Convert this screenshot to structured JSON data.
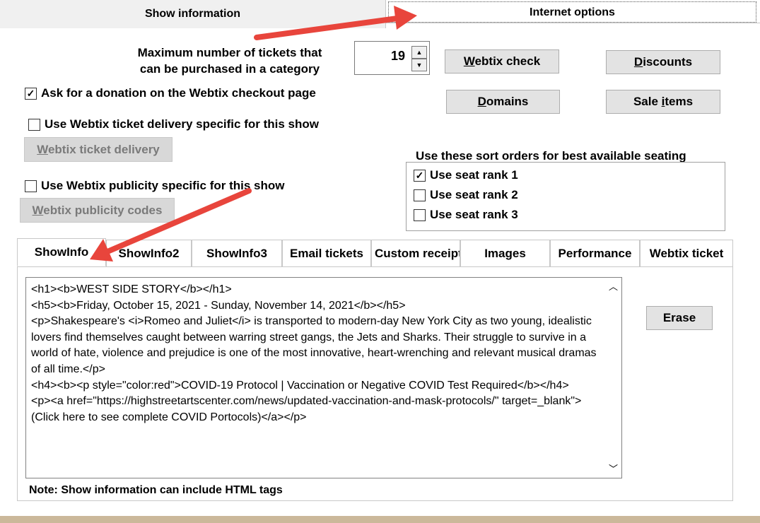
{
  "top_tabs": {
    "show_information": "Show information",
    "internet_options": "Internet options"
  },
  "max_tickets": {
    "label_line1": "Maximum number of tickets that",
    "label_line2": "can be purchased in a category",
    "value": "19"
  },
  "buttons": {
    "webtix_check_u": "W",
    "webtix_check_rest": "ebtix check",
    "discounts_u": "D",
    "discounts_rest": "iscounts",
    "domains_u": "D",
    "domains_rest": "omains",
    "sale_items_pre": "Sale ",
    "sale_items_u": "i",
    "sale_items_rest": "tems",
    "webtix_delivery_u": "W",
    "webtix_delivery_rest": "ebtix ticket delivery",
    "webtix_publicity_u": "W",
    "webtix_publicity_rest": "ebtix publicity codes",
    "erase": "Erase"
  },
  "checkboxes": {
    "donation": {
      "label": "Ask for a donation on the Webtix checkout page",
      "checked": true
    },
    "delivery": {
      "label": "Use Webtix ticket delivery specific for this show",
      "checked": false
    },
    "publicity": {
      "label": "Use Webtix publicity specific for this show",
      "checked": false
    }
  },
  "sort_orders": {
    "title": "Use these sort orders for best available seating",
    "items": [
      {
        "label": "Use seat rank 1",
        "checked": true
      },
      {
        "label": "Use seat rank 2",
        "checked": false
      },
      {
        "label": "Use seat rank 3",
        "checked": false
      }
    ]
  },
  "inner_tabs": [
    "ShowInfo",
    "ShowInfo2",
    "ShowInfo3",
    "Email tickets",
    "Custom receipt",
    "Images",
    "Performance",
    "Webtix ticket"
  ],
  "editor_text": "<h1><b>WEST SIDE STORY</b></h1>\n<h5><b>Friday, October 15, 2021 - Sunday, November 14, 2021</b></h5>\n<p>Shakespeare's <i>Romeo and Juliet</i> is transported to modern-day New York City as two young, idealistic lovers find themselves caught between warring street gangs, the Jets and Sharks. Their struggle to survive in a world of hate, violence and prejudice is one of the most innovative, heart-wrenching and relevant musical dramas of all time.</p>\n<h4><b><p style=\"color:red\">COVID-19 Protocol | Vaccination or Negative COVID Test Required</b></h4>\n<p><a href=\"https://highstreetartscenter.com/news/updated-vaccination-and-mask-protocols/\" target=_blank\">(Click here to see complete COVID Portocols)</a></p>",
  "note": "Note: Show information can include HTML tags",
  "colors": {
    "annotation_arrow": "#e8453c",
    "bottom_bar": "#cbb89a"
  }
}
